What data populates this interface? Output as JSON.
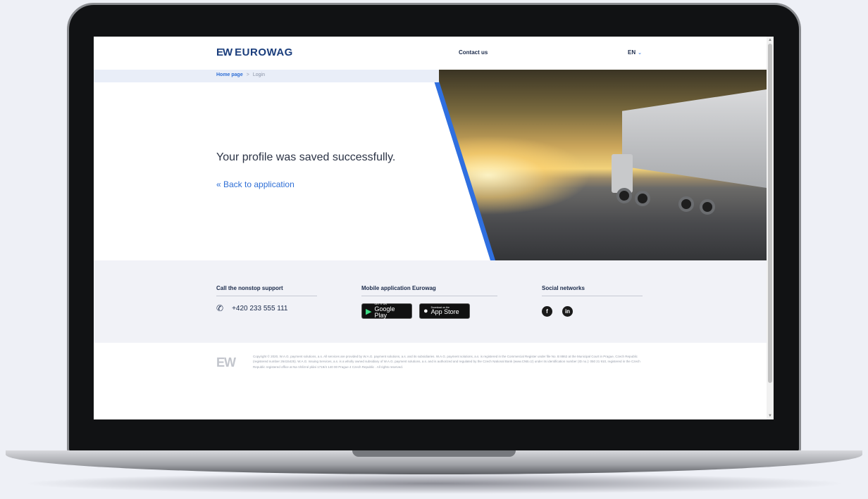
{
  "header": {
    "logo_mark": "EW",
    "logo_text": "EUROWAG",
    "contact_label": "Contact us",
    "language": "EN"
  },
  "breadcrumb": {
    "home": "Home page",
    "separator": ">",
    "current": "Login"
  },
  "main": {
    "message": "Your profile was saved successfully.",
    "back_link": "« Back to application"
  },
  "footer": {
    "support_title": "Call the nonstop support",
    "phone": "+420 233 555 111",
    "apps_title": "Mobile application Eurowag",
    "google_play_small": "GET IT ON",
    "google_play_big": "Google Play",
    "app_store_small": "Download on the",
    "app_store_big": "App Store",
    "social_title": "Social networks",
    "facebook": "f",
    "linkedin": "in"
  },
  "legal": {
    "logo": "EW",
    "text": "Copyright © 2020, W.A.G. payment solutions, a.s. All services are provided by W.A.G. payment solutions, a.s. and its subsidiaries. W.A.G. payment solutions, a.s. is registered in the Commercial Register under file No. B 8862 at the Municipal Court in Prague, Czech Republic (registered number 26415425). W.A.G. Issuing Services, a.s. is a wholly owned subsidiary of W.A.G. payment solutions, a.s. and is authorized and regulated by the Czech National Bank (www.CNB.cz) under its identification number (ID no.): 050 21 910, registered in the Czech Republic registered office at Na Vítězné pláni 1719/4 140 00 Prague 4 Czech Republic . All rights reserved."
  },
  "colors": {
    "brand": "#1a3d7c",
    "accent": "#2f6fe0",
    "footer_bg": "#f1f2f7"
  }
}
